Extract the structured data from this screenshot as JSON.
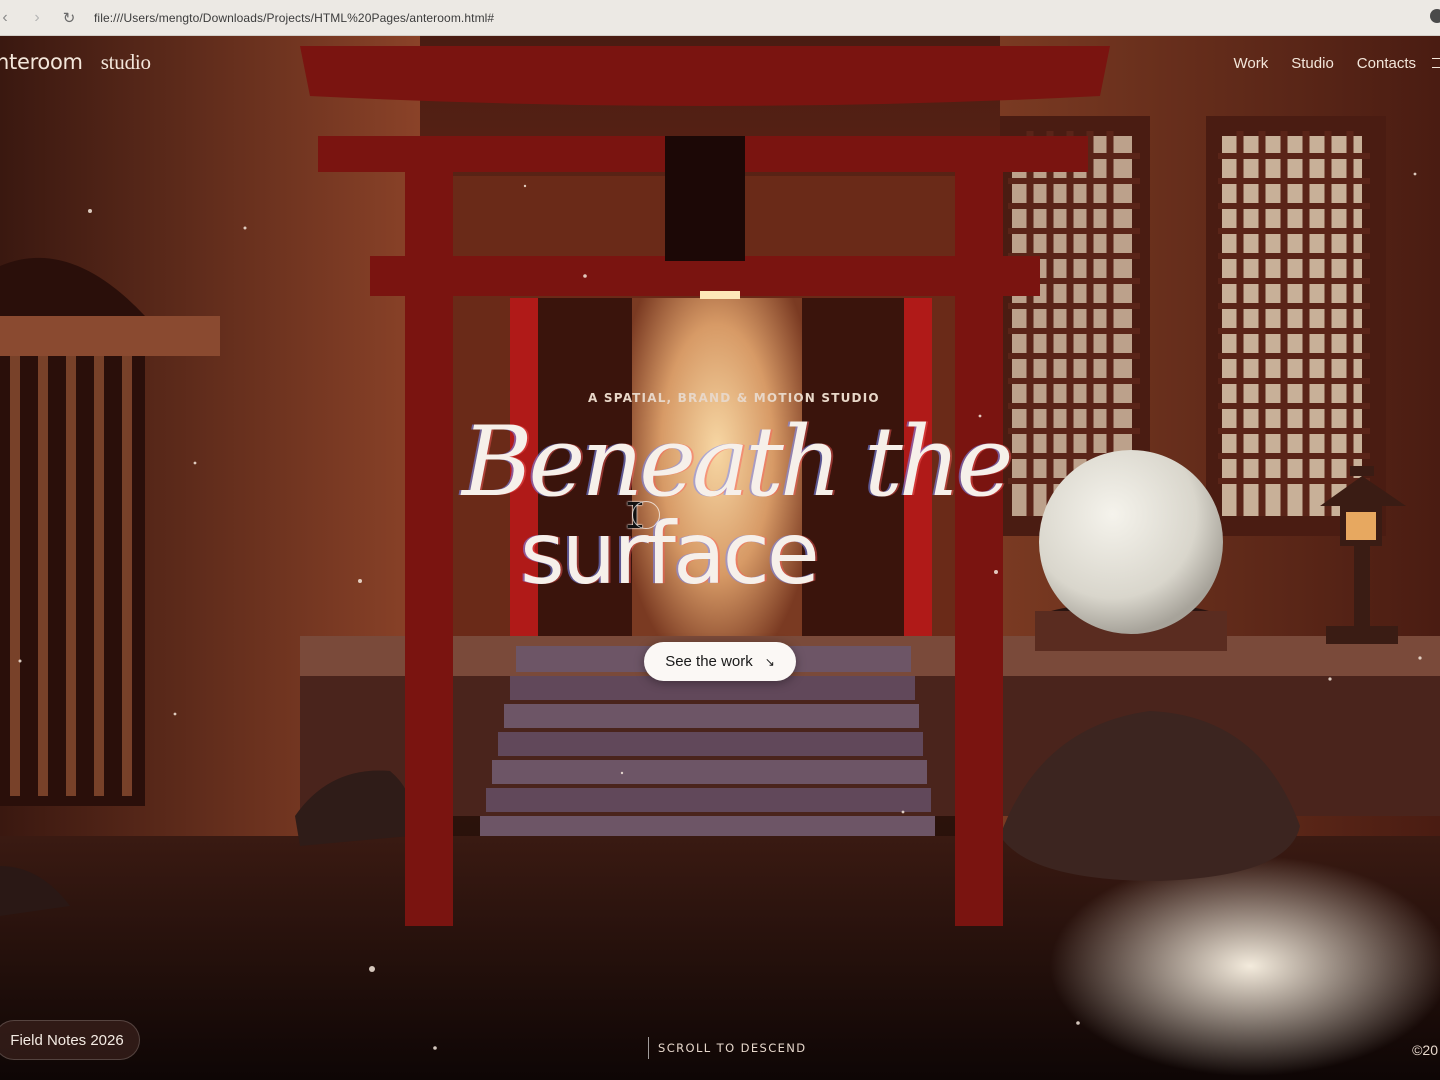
{
  "browser": {
    "url": "file:///Users/mengto/Downloads/Projects/HTML%20Pages/anteroom.html#"
  },
  "header": {
    "brand_name": "nteroom",
    "brand_sub": "studio",
    "nav": [
      "Work",
      "Studio",
      "Contacts"
    ]
  },
  "hero": {
    "eyebrow": "A SPATIAL, BRAND & MOTION STUDIO",
    "title_line1": "Beneath the",
    "title_line2": "surface",
    "cta_label": "See the work",
    "cta_icon": "arrow-down-right-icon"
  },
  "footer": {
    "field_notes": "Field Notes 2026",
    "scroll_hint": "SCROLL TO DESCEND",
    "copyright": "©20"
  },
  "colors": {
    "torii_red": "#7a1410",
    "wall": "#6b2c1a",
    "glow": "#f4c98a",
    "text": "#f6f0ea"
  }
}
